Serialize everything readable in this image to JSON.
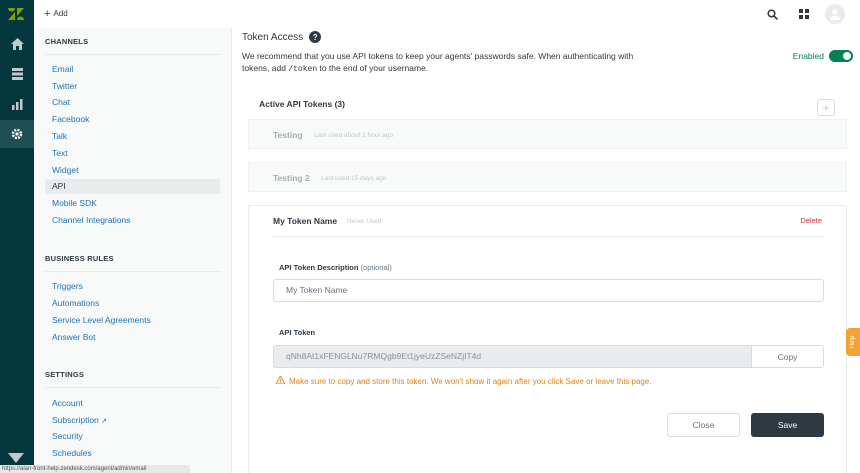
{
  "header": {
    "add_label": "Add"
  },
  "rail": {
    "icons": [
      "zendesk-logo",
      "home-icon",
      "views-icon",
      "reporting-icon",
      "admin-gear-icon"
    ]
  },
  "sidebar": {
    "channels": {
      "heading": "CHANNELS",
      "items": [
        {
          "label": "Email"
        },
        {
          "label": "Twitter"
        },
        {
          "label": "Chat"
        },
        {
          "label": "Facebook"
        },
        {
          "label": "Talk"
        },
        {
          "label": "Text"
        },
        {
          "label": "Widget"
        },
        {
          "label": "API"
        },
        {
          "label": "Mobile SDK"
        },
        {
          "label": "Channel Integrations"
        }
      ]
    },
    "business_rules": {
      "heading": "BUSINESS RULES",
      "items": [
        {
          "label": "Triggers"
        },
        {
          "label": "Automations"
        },
        {
          "label": "Service Level Agreements"
        },
        {
          "label": "Answer Bot"
        }
      ]
    },
    "settings": {
      "heading": "SETTINGS",
      "items": [
        {
          "label": "Account"
        },
        {
          "label": "Subscription"
        },
        {
          "label": "Security"
        },
        {
          "label": "Schedules"
        }
      ]
    }
  },
  "statusbar": {
    "url": "https://alan-front-help.zendesk.com/agent/admin/email"
  },
  "main": {
    "title": "Token Access",
    "help_glyph": "?",
    "desc_before": "We recommend that you use API tokens to keep your agents' passwords safe. When authenticating with tokens, add ",
    "desc_code": "/token",
    "desc_after": " to the end of your username.",
    "enabled_label": "Enabled",
    "enabled": true,
    "active_tokens_label": "Active API Tokens (3)",
    "tokens": [
      {
        "name": "Testing",
        "last_used": "Last used about 1 hour ago"
      },
      {
        "name": "Testing 2",
        "last_used": "Last used 15 days ago"
      }
    ],
    "edit_card": {
      "name": "My Token Name",
      "last_used": "Never Used",
      "delete_label": "Delete",
      "description_label": "API Token Description",
      "description_optional": "(optional)",
      "description_value": "My Token Name",
      "token_label": "API Token",
      "token_value": "qNh8At1xFENGLNu7RMQgb9Et1jyeUzZSeNZjIT4d",
      "copy_label": "Copy",
      "warning": "Make sure to copy and store this token. We won't show it again after you click Save or leave this page.",
      "close_label": "Close",
      "save_label": "Save"
    }
  },
  "help_tab_label": "Help",
  "colors": {
    "rail_bg": "#03363d",
    "link": "#1f73b7",
    "enabled_green": "#038153",
    "delete_red": "#cc3340",
    "warning_orange": "#e38215",
    "save_bg": "#2f3941",
    "help_tab": "#f5a133"
  }
}
